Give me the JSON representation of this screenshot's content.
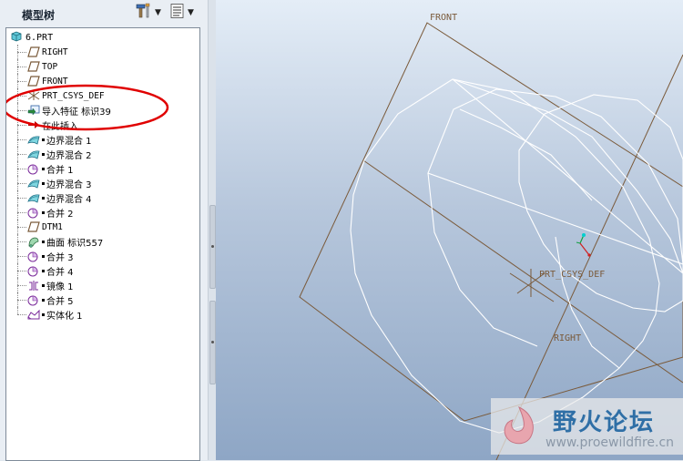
{
  "panel": {
    "title": "模型树"
  },
  "tree": {
    "root": "6.PRT",
    "items": [
      {
        "label": "RIGHT",
        "icon": "datum-plane-icon"
      },
      {
        "label": "TOP",
        "icon": "datum-plane-icon"
      },
      {
        "label": "FRONT",
        "icon": "datum-plane-icon"
      },
      {
        "label": "PRT_CSYS_DEF",
        "icon": "coordinate-system-icon"
      },
      {
        "label": "导入特征 标识39",
        "icon": "import-feature-icon"
      },
      {
        "label": "在此插入",
        "icon": "insert-here-arrow-icon"
      },
      {
        "label": "边界混合 1",
        "icon": "boundary-blend-icon"
      },
      {
        "label": "边界混合 2",
        "icon": "boundary-blend-icon"
      },
      {
        "label": "合并 1",
        "icon": "merge-icon"
      },
      {
        "label": "边界混合 3",
        "icon": "boundary-blend-icon"
      },
      {
        "label": "边界混合 4",
        "icon": "boundary-blend-icon"
      },
      {
        "label": "合并 2",
        "icon": "merge-icon"
      },
      {
        "label": "DTM1",
        "icon": "datum-plane-icon"
      },
      {
        "label": "曲面 标识557",
        "icon": "surface-icon"
      },
      {
        "label": "合并 3",
        "icon": "merge-icon"
      },
      {
        "label": "合并 4",
        "icon": "merge-icon"
      },
      {
        "label": "镜像 1",
        "icon": "mirror-icon"
      },
      {
        "label": "合并 5",
        "icon": "merge-icon"
      },
      {
        "label": "实体化 1",
        "icon": "solidify-icon"
      }
    ]
  },
  "viewport": {
    "labels": {
      "front": "FRONT",
      "csys": "PRT_CSYS_DEF",
      "right": "RIGHT"
    }
  },
  "watermark": {
    "title": "野火论坛",
    "url": "www.proewildfire.cn"
  },
  "colors": {
    "datum": "#7a5a3a",
    "annotation": "#e00000",
    "wireframe": "#ffffff"
  }
}
